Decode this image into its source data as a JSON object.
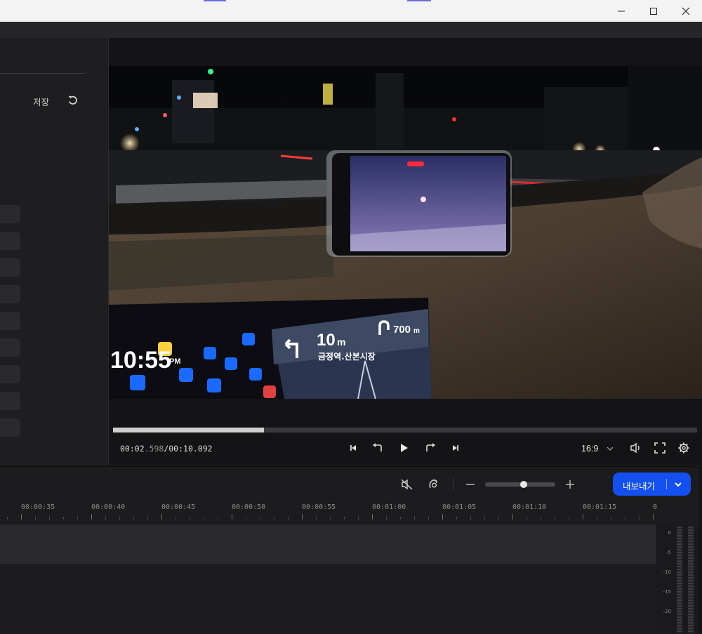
{
  "window": {
    "minimize_icon": "minimize-icon",
    "maximize_icon": "maximize-icon",
    "close_icon": "close-icon"
  },
  "left_panel": {
    "save_label": "저장",
    "reset_icon": "undo-icon"
  },
  "player": {
    "current_time": "00:02",
    "current_ms": ".598",
    "total_time": "/00:10.092",
    "progress": 0.258,
    "aspect_ratio": "16:9"
  },
  "video_overlay": {
    "clock": "10:55",
    "clock_suffix": "PM",
    "nav_distance": "10",
    "nav_unit": "m",
    "nav_street": "금정역.산본시장",
    "nav_next_distance": "700",
    "nav_next_unit": "m"
  },
  "timeline": {
    "export_label": "내보내기",
    "zoom_level": 0.55,
    "ruler": [
      "00:00:35",
      "00:00:40",
      "00:00:45",
      "00:00:50",
      "00:00:55",
      "00:01:00",
      "00:01:05",
      "00:01:10",
      "00:01:15",
      "0"
    ],
    "meter_scale": [
      "0",
      "-5",
      "-10",
      "-15",
      "-20"
    ]
  },
  "colors": {
    "accent": "#1450f0",
    "background": "#1a1a1b"
  }
}
